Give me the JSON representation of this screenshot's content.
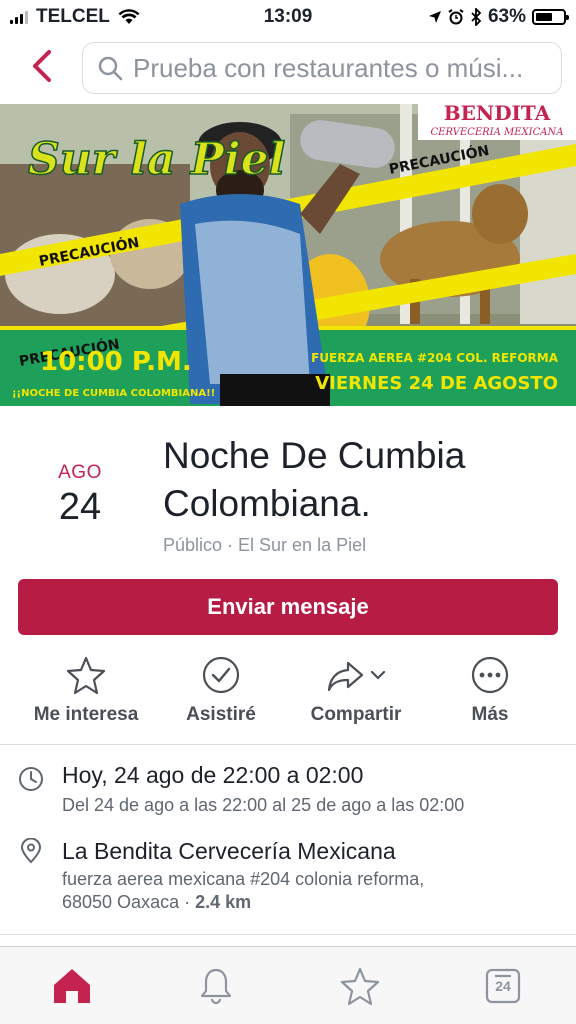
{
  "status": {
    "carrier": "TELCEL",
    "time": "13:09",
    "battery": "63%",
    "battery_level": 0.63
  },
  "search": {
    "placeholder": "Prueba con restaurantes o músi..."
  },
  "banner": {
    "title_script": "Sur la Piel",
    "brand": "BENDITA",
    "brand_sub": "CERVECERIA MEXICANA",
    "tape_text": "PRECAUCIÓN",
    "time": "10:00 P.M.",
    "tagline": "¡¡NOCHE DE CUMBIA COLOMBIANA!!",
    "address": "FUERZA AEREA #204 COL. REFORMA",
    "date": "VIERNES 24 DE AGOSTO"
  },
  "event": {
    "month": "AGO",
    "day": "24",
    "title": "Noche De Cumbia Colombiana.",
    "subtitle": "Público · El Sur en la Piel",
    "message_button": "Enviar mensaje"
  },
  "actions": [
    {
      "label": "Me interesa",
      "icon": "star-icon"
    },
    {
      "label": "Asistiré",
      "icon": "check-circle-icon"
    },
    {
      "label": "Compartir",
      "icon": "share-icon"
    },
    {
      "label": "Más",
      "icon": "more-icon"
    }
  ],
  "details": {
    "time_main": "Hoy, 24 ago de 22:00 a 02:00",
    "time_sub": "Del 24 de ago a las 22:00 al 25 de ago a las 02:00",
    "place_main": "La Bendita Cervecería Mexicana",
    "place_address_line1": "fuerza aerea mexicana #204 colonia reforma,",
    "place_address_line2": "68050 Oaxaca · ",
    "place_distance": "2.4 km"
  },
  "tabbar": {
    "calendar_day": "24"
  },
  "colors": {
    "accent": "#c4234f",
    "button": "#b71c45",
    "banner_green": "#1fa05a",
    "banner_yellow": "#f2e600"
  }
}
